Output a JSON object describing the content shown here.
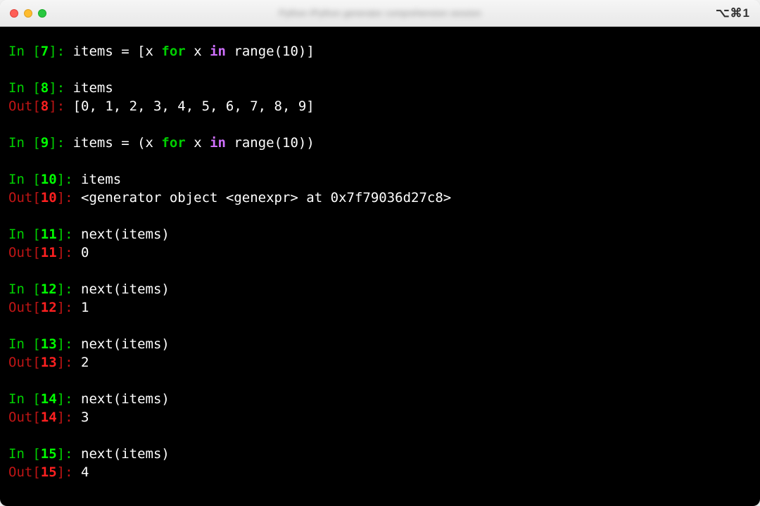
{
  "titlebar": {
    "title_blurred": "Python IPython generator comprehension session",
    "shortcut": "⌥⌘1"
  },
  "colors": {
    "in_label": "#00d000",
    "out_label": "#c01515",
    "num_green": "#00ff00",
    "num_red": "#ff2020",
    "kw_for": "#00d000",
    "kw_in": "#d070ff",
    "background": "#000000",
    "text": "#ffffff"
  },
  "cells": [
    {
      "n": "7",
      "in_tokens": [
        {
          "t": "items = [x ",
          "c": "plain"
        },
        {
          "t": "for",
          "c": "kw-for"
        },
        {
          "t": " x ",
          "c": "plain"
        },
        {
          "t": "in",
          "c": "kw-in"
        },
        {
          "t": " range(10)]",
          "c": "plain"
        }
      ]
    },
    {
      "n": "8",
      "in_tokens": [
        {
          "t": "items",
          "c": "plain"
        }
      ],
      "out": "[0, 1, 2, 3, 4, 5, 6, 7, 8, 9]"
    },
    {
      "n": "9",
      "in_tokens": [
        {
          "t": "items = (x ",
          "c": "plain"
        },
        {
          "t": "for",
          "c": "kw-for"
        },
        {
          "t": " x ",
          "c": "plain"
        },
        {
          "t": "in",
          "c": "kw-in"
        },
        {
          "t": " range(10))",
          "c": "plain"
        }
      ]
    },
    {
      "n": "10",
      "in_tokens": [
        {
          "t": "items",
          "c": "plain"
        }
      ],
      "out": "<generator object <genexpr> at 0x7f79036d27c8>"
    },
    {
      "n": "11",
      "in_tokens": [
        {
          "t": "next(items)",
          "c": "plain"
        }
      ],
      "out": "0"
    },
    {
      "n": "12",
      "in_tokens": [
        {
          "t": "next(items)",
          "c": "plain"
        }
      ],
      "out": "1"
    },
    {
      "n": "13",
      "in_tokens": [
        {
          "t": "next(items)",
          "c": "plain"
        }
      ],
      "out": "2"
    },
    {
      "n": "14",
      "in_tokens": [
        {
          "t": "next(items)",
          "c": "plain"
        }
      ],
      "out": "3"
    },
    {
      "n": "15",
      "in_tokens": [
        {
          "t": "next(items)",
          "c": "plain"
        }
      ],
      "out": "4"
    }
  ],
  "labels": {
    "in": "In ",
    "out": "Out"
  }
}
